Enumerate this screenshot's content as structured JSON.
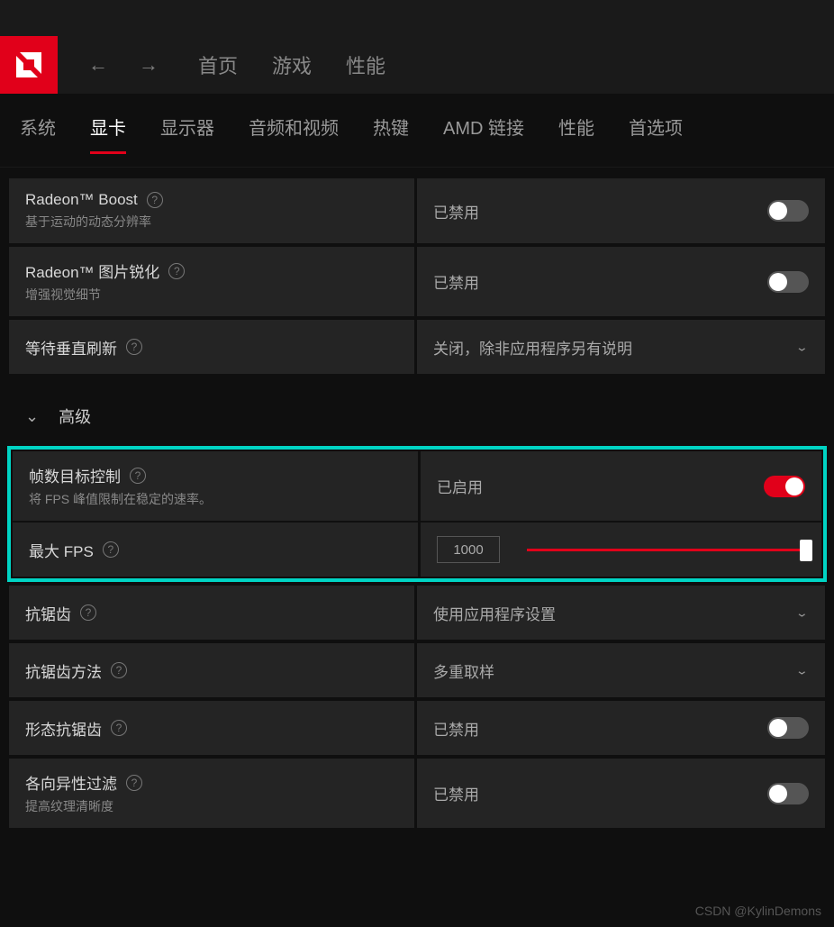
{
  "topnav": {
    "items": [
      "首页",
      "游戏",
      "性能"
    ]
  },
  "tabs": [
    "系统",
    "显卡",
    "显示器",
    "音频和视频",
    "热键",
    "AMD 链接",
    "性能",
    "首选项"
  ],
  "active_tab": 1,
  "rows": {
    "boost": {
      "title": "Radeon™ Boost",
      "sub": "基于运动的动态分辨率",
      "status": "已禁用"
    },
    "sharpen": {
      "title": "Radeon™ 图片锐化",
      "sub": "增强视觉细节",
      "status": "已禁用"
    },
    "vsync": {
      "title": "等待垂直刷新",
      "status": "关闭，除非应用程序另有说明"
    },
    "frc": {
      "title": "帧数目标控制",
      "sub": "将 FPS 峰值限制在稳定的速率。",
      "status": "已启用"
    },
    "maxfps": {
      "title": "最大 FPS",
      "value": "1000"
    },
    "aa": {
      "title": "抗锯齿",
      "status": "使用应用程序设置"
    },
    "aamethod": {
      "title": "抗锯齿方法",
      "status": "多重取样"
    },
    "morphaa": {
      "title": "形态抗锯齿",
      "status": "已禁用"
    },
    "aniso": {
      "title": "各向异性过滤",
      "sub": "提高纹理清晰度",
      "status": "已禁用"
    }
  },
  "section": {
    "advanced": "高级"
  },
  "watermark": "CSDN @KylinDemons"
}
